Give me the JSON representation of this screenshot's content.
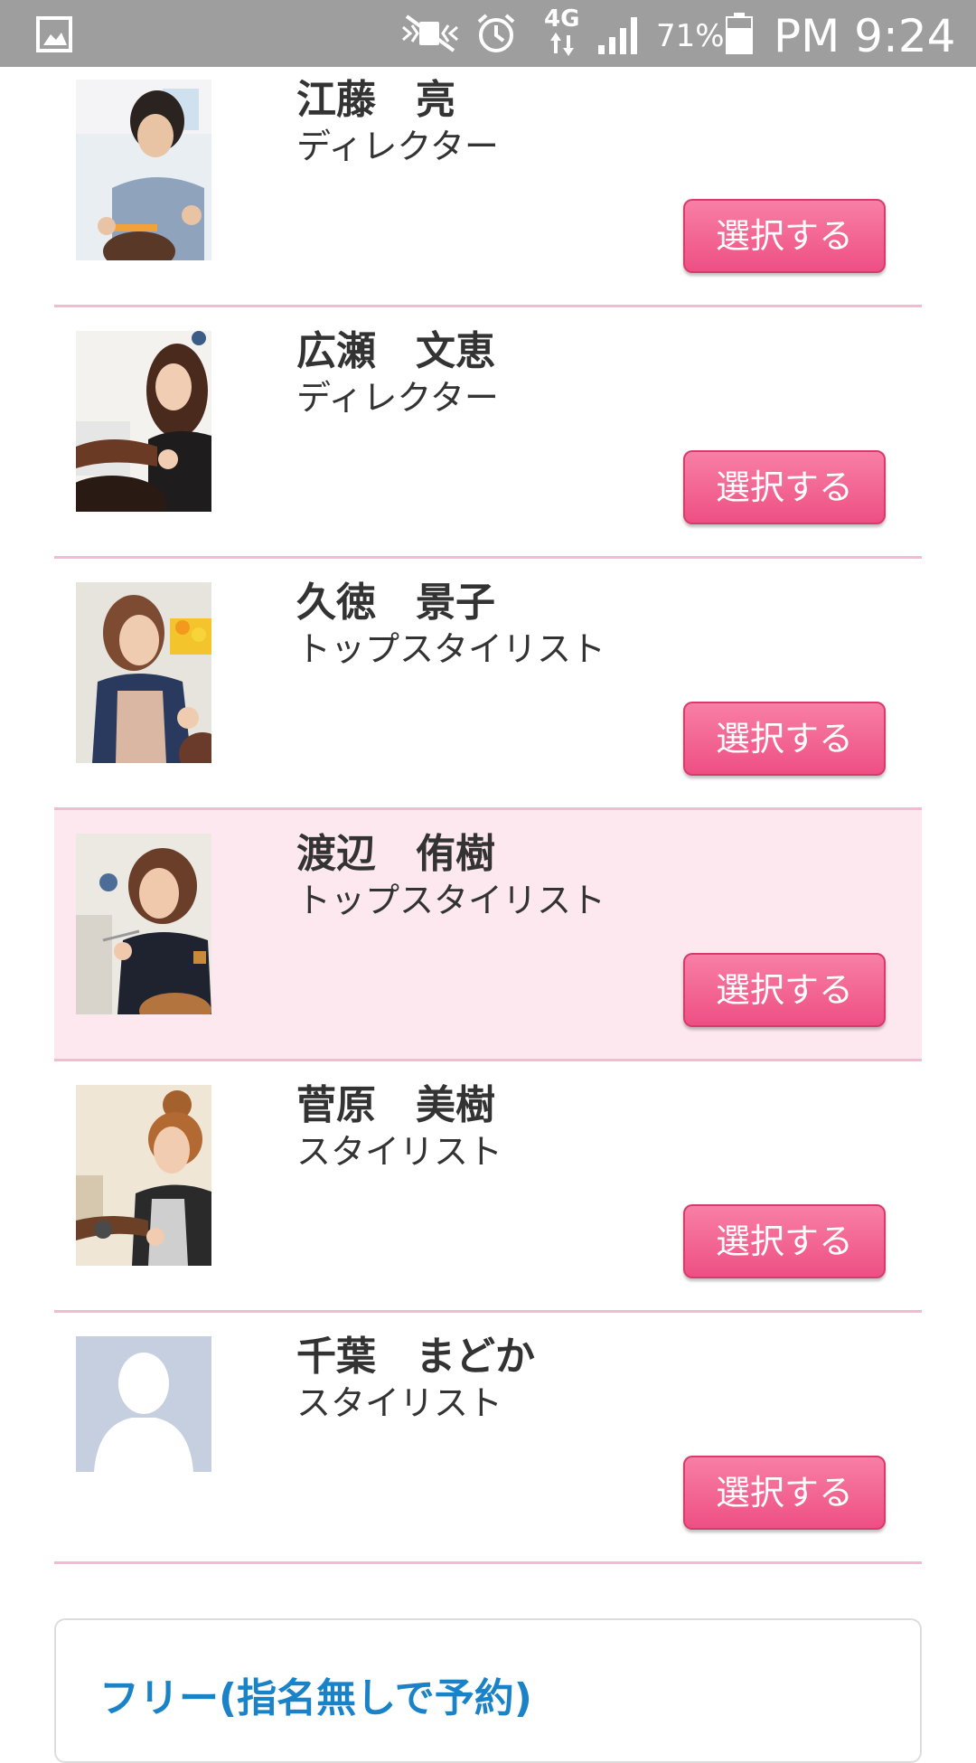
{
  "status_bar": {
    "network": "4G",
    "battery": "71%",
    "time": "PM 9:24",
    "icons": [
      "gallery-icon",
      "mute-icon",
      "alarm-icon",
      "signal-icon",
      "battery-icon"
    ]
  },
  "staff": [
    {
      "name": "江藤　亮",
      "role": "ディレクター",
      "photo": "stylist-photo",
      "button": "選択する"
    },
    {
      "name": "広瀬　文恵",
      "role": "ディレクター",
      "photo": "stylist-photo",
      "button": "選択する"
    },
    {
      "name": "久徳　景子",
      "role": "トップスタイリスト",
      "photo": "stylist-photo",
      "button": "選択する"
    },
    {
      "name": "渡辺　侑樹",
      "role": "トップスタイリスト",
      "photo": "stylist-photo",
      "button": "選択する",
      "highlighted": true
    },
    {
      "name": "菅原　美樹",
      "role": "スタイリスト",
      "photo": "stylist-photo",
      "button": "選択する"
    },
    {
      "name": "千葉　まどか",
      "role": "スタイリスト",
      "photo": "default-avatar",
      "button": "選択する"
    }
  ],
  "free_option": {
    "title": "フリー(指名無しで予約)"
  },
  "colors": {
    "accent_pink": "#ee4f84",
    "divider_pink": "#f7b9d2",
    "highlight_bg": "#fde8ef",
    "link_blue": "#1a83c8",
    "status_bar": "#9e9e9e"
  }
}
